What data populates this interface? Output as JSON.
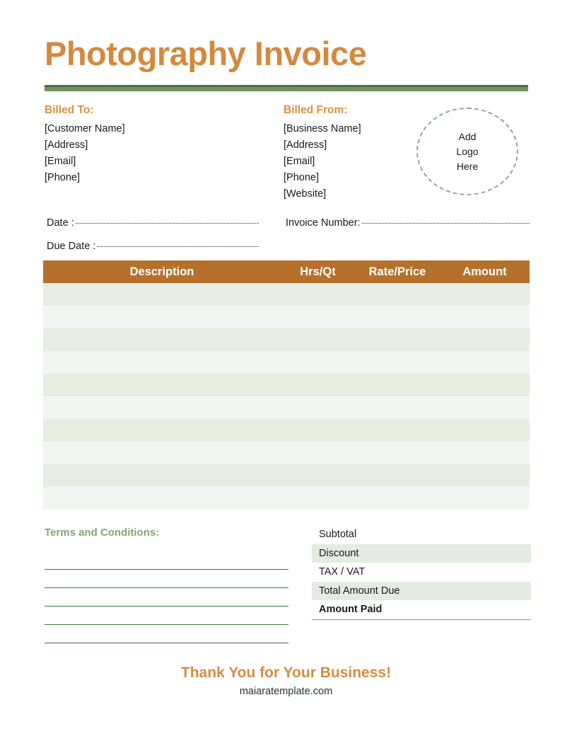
{
  "document": {
    "title": "Photography Invoice"
  },
  "billed_to": {
    "heading": "Billed To:",
    "lines": [
      "[Customer Name]",
      "[Address]",
      "[Email]",
      "[Phone]"
    ]
  },
  "billed_from": {
    "heading": "Billed From:",
    "lines": [
      "[Business Name]",
      "[Address]",
      "[Email]",
      "[Phone]",
      "[Website]"
    ]
  },
  "logo": {
    "line1": "Add",
    "line2": "Logo",
    "line3": "Here"
  },
  "meta": {
    "date_label": "Date :",
    "due_date_label": "Due Date :",
    "invoice_number_label": "Invoice Number:",
    "date_value": "",
    "due_date_value": "",
    "invoice_number_value": ""
  },
  "items_table": {
    "columns": [
      "Description",
      "Hrs/Qt",
      "Rate/Price",
      "Amount"
    ],
    "row_count": 10,
    "rows": [
      {
        "description": "",
        "hrs_qt": "",
        "rate_price": "",
        "amount": ""
      },
      {
        "description": "",
        "hrs_qt": "",
        "rate_price": "",
        "amount": ""
      },
      {
        "description": "",
        "hrs_qt": "",
        "rate_price": "",
        "amount": ""
      },
      {
        "description": "",
        "hrs_qt": "",
        "rate_price": "",
        "amount": ""
      },
      {
        "description": "",
        "hrs_qt": "",
        "rate_price": "",
        "amount": ""
      },
      {
        "description": "",
        "hrs_qt": "",
        "rate_price": "",
        "amount": ""
      },
      {
        "description": "",
        "hrs_qt": "",
        "rate_price": "",
        "amount": ""
      },
      {
        "description": "",
        "hrs_qt": "",
        "rate_price": "",
        "amount": ""
      },
      {
        "description": "",
        "hrs_qt": "",
        "rate_price": "",
        "amount": ""
      },
      {
        "description": "",
        "hrs_qt": "",
        "rate_price": "",
        "amount": ""
      }
    ]
  },
  "terms": {
    "heading": "Terms and Conditions:",
    "line_count": 5,
    "lines": [
      "",
      "",
      "",
      "",
      ""
    ]
  },
  "totals": {
    "rows": [
      {
        "label": "Subtotal",
        "value": ""
      },
      {
        "label": "Discount",
        "value": ""
      },
      {
        "label": "TAX / VAT",
        "value": ""
      },
      {
        "label": "Total Amount Due",
        "value": ""
      },
      {
        "label": "Amount Paid",
        "value": ""
      }
    ]
  },
  "footer": {
    "thanks": "Thank You for Your Business!",
    "website": "maiaratemplate.com"
  },
  "colors": {
    "title_orange": "#d38a3f",
    "heading_orange": "#dd9040",
    "divider_green": "#6f9364",
    "divider_green_dark": "#4e6f47",
    "table_header_brown": "#b5712c",
    "row_shade_dark": "#e7ede3",
    "row_shade_light": "#f1f6f1",
    "terms_green": "#85a474",
    "rule_green": "#3f7340",
    "logo_dash_gray": "#8fa8a0"
  }
}
